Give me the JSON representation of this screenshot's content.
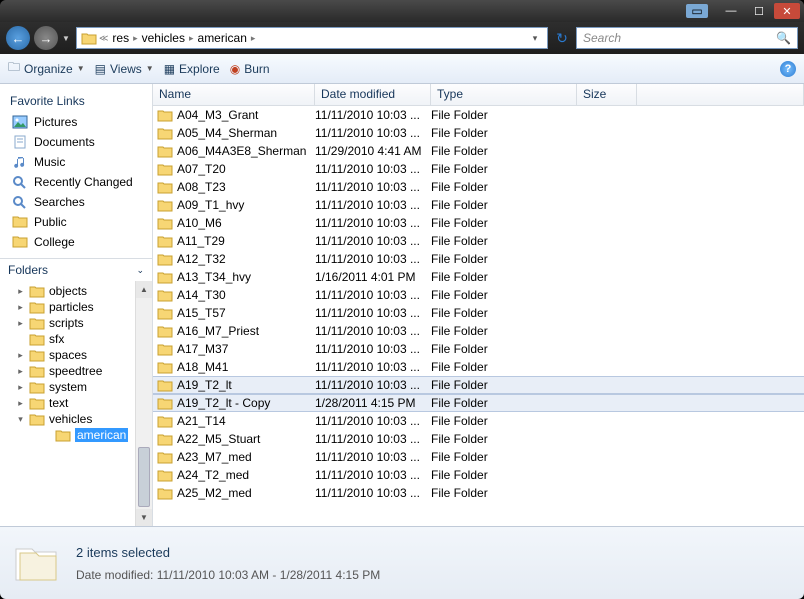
{
  "titlebar": {
    "min": "—",
    "max": "☐",
    "close": "✕"
  },
  "nav": {
    "back_glyph": "←",
    "fwd_glyph": "→",
    "crumbs": [
      "res",
      "vehicles",
      "american"
    ],
    "refresh_glyph": "↻"
  },
  "search": {
    "placeholder": "Search",
    "icon": "🔍"
  },
  "toolbar": {
    "organize": "Organize",
    "views": "Views",
    "explore": "Explore",
    "burn": "Burn",
    "help": "?"
  },
  "sidebar": {
    "fav_heading": "Favorite Links",
    "favorites": [
      {
        "label": "Pictures",
        "icon": "picture"
      },
      {
        "label": "Documents",
        "icon": "document"
      },
      {
        "label": "Music",
        "icon": "music"
      },
      {
        "label": "Recently Changed",
        "icon": "search"
      },
      {
        "label": "Searches",
        "icon": "search"
      },
      {
        "label": "Public",
        "icon": "folder"
      },
      {
        "label": "College",
        "icon": "folder"
      }
    ],
    "folders_heading": "Folders",
    "tree": [
      {
        "label": "objects",
        "expandable": true
      },
      {
        "label": "particles",
        "expandable": true
      },
      {
        "label": "scripts",
        "expandable": true
      },
      {
        "label": "sfx",
        "expandable": false
      },
      {
        "label": "spaces",
        "expandable": true
      },
      {
        "label": "speedtree",
        "expandable": true
      },
      {
        "label": "system",
        "expandable": true
      },
      {
        "label": "text",
        "expandable": true
      },
      {
        "label": "vehicles",
        "expandable": true,
        "expanded": true,
        "children": [
          {
            "label": "american",
            "selected": true
          }
        ]
      }
    ]
  },
  "columns": {
    "name": "Name",
    "date": "Date modified",
    "type": "Type",
    "size": "Size"
  },
  "files": [
    {
      "name": "A04_M3_Grant",
      "date": "11/11/2010 10:03 ...",
      "type": "File Folder"
    },
    {
      "name": "A05_M4_Sherman",
      "date": "11/11/2010 10:03 ...",
      "type": "File Folder"
    },
    {
      "name": "A06_M4A3E8_Sherman",
      "date": "11/29/2010 4:41 AM",
      "type": "File Folder"
    },
    {
      "name": "A07_T20",
      "date": "11/11/2010 10:03 ...",
      "type": "File Folder"
    },
    {
      "name": "A08_T23",
      "date": "11/11/2010 10:03 ...",
      "type": "File Folder"
    },
    {
      "name": "A09_T1_hvy",
      "date": "11/11/2010 10:03 ...",
      "type": "File Folder"
    },
    {
      "name": "A10_M6",
      "date": "11/11/2010 10:03 ...",
      "type": "File Folder"
    },
    {
      "name": "A11_T29",
      "date": "11/11/2010 10:03 ...",
      "type": "File Folder"
    },
    {
      "name": "A12_T32",
      "date": "11/11/2010 10:03 ...",
      "type": "File Folder"
    },
    {
      "name": "A13_T34_hvy",
      "date": "1/16/2011 4:01 PM",
      "type": "File Folder"
    },
    {
      "name": "A14_T30",
      "date": "11/11/2010 10:03 ...",
      "type": "File Folder"
    },
    {
      "name": "A15_T57",
      "date": "11/11/2010 10:03 ...",
      "type": "File Folder"
    },
    {
      "name": "A16_M7_Priest",
      "date": "11/11/2010 10:03 ...",
      "type": "File Folder"
    },
    {
      "name": "A17_M37",
      "date": "11/11/2010 10:03 ...",
      "type": "File Folder"
    },
    {
      "name": "A18_M41",
      "date": "11/11/2010 10:03 ...",
      "type": "File Folder"
    },
    {
      "name": "A19_T2_lt",
      "date": "11/11/2010 10:03 ...",
      "type": "File Folder",
      "selected": true
    },
    {
      "name": "A19_T2_lt - Copy",
      "date": "1/28/2011 4:15 PM",
      "type": "File Folder",
      "selected": true
    },
    {
      "name": "A21_T14",
      "date": "11/11/2010 10:03 ...",
      "type": "File Folder"
    },
    {
      "name": "A22_M5_Stuart",
      "date": "11/11/2010 10:03 ...",
      "type": "File Folder"
    },
    {
      "name": "A23_M7_med",
      "date": "11/11/2010 10:03 ...",
      "type": "File Folder"
    },
    {
      "name": "A24_T2_med",
      "date": "11/11/2010 10:03 ...",
      "type": "File Folder"
    },
    {
      "name": "A25_M2_med",
      "date": "11/11/2010 10:03 ...",
      "type": "File Folder"
    }
  ],
  "details": {
    "title": "2 items selected",
    "date_label": "Date modified:",
    "date_value": "11/11/2010 10:03 AM - 1/28/2011 4:15 PM"
  }
}
